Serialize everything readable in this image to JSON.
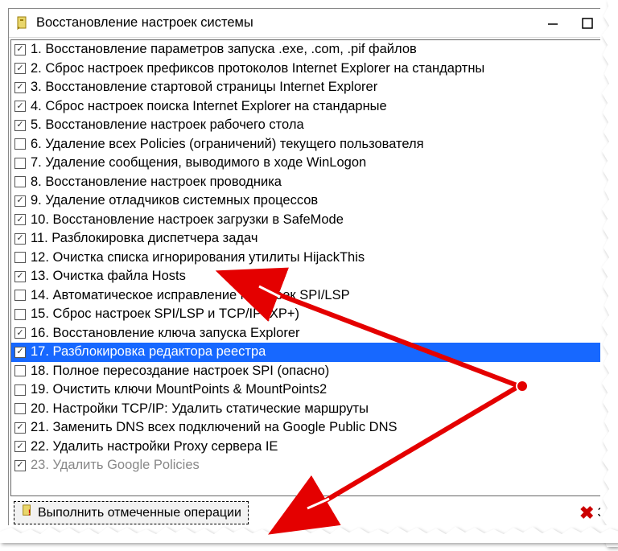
{
  "window": {
    "title": "Восстановление настроек системы"
  },
  "items": [
    {
      "checked": true,
      "label": "1. Восстановление параметров запуска .exe, .com, .pif файлов"
    },
    {
      "checked": true,
      "label": "2. Сброс настроек префиксов протоколов Internet Explorer на стандартны"
    },
    {
      "checked": true,
      "label": "3. Восстановление стартовой страницы Internet Explorer"
    },
    {
      "checked": true,
      "label": "4. Сброс настроек поиска Internet Explorer на стандарные"
    },
    {
      "checked": true,
      "label": "5. Восстановление настроек рабочего стола"
    },
    {
      "checked": false,
      "label": "6. Удаление всех Policies (ограничений) текущего пользователя"
    },
    {
      "checked": false,
      "label": "7. Удаление сообщения, выводимого в ходе WinLogon"
    },
    {
      "checked": false,
      "label": "8. Восстановление настроек проводника"
    },
    {
      "checked": true,
      "label": "9. Удаление отладчиков системных процессов"
    },
    {
      "checked": true,
      "label": "10. Восстановление настроек загрузки в SafeMode"
    },
    {
      "checked": true,
      "label": "11. Разблокировка диспетчера задач"
    },
    {
      "checked": false,
      "label": "12. Очистка списка игнорирования утилиты HijackThis"
    },
    {
      "checked": true,
      "label": "13. Очистка файла Hosts"
    },
    {
      "checked": false,
      "label": "14. Автоматическое исправление настроек SPI/LSP"
    },
    {
      "checked": false,
      "label": "15. Сброс настроек SPI/LSP и TCP/IP (XP+)"
    },
    {
      "checked": true,
      "label": "16. Восстановление ключа запуска Explorer"
    },
    {
      "checked": true,
      "label": "17. Разблокировка редактора реестра",
      "selected": true
    },
    {
      "checked": false,
      "label": "18. Полное пересоздание настроек SPI (опасно)"
    },
    {
      "checked": false,
      "label": "19. Очистить ключи MountPoints & MountPoints2"
    },
    {
      "checked": false,
      "label": "20. Настройки TCP/IP: Удалить статические маршруты"
    },
    {
      "checked": true,
      "label": "21. Заменить DNS всех подключений на Google Public DNS"
    },
    {
      "checked": true,
      "label": "22. Удалить настройки Proxy сервера IE"
    },
    {
      "checked": true,
      "label": "23. Удалить Google Policies",
      "partial": true
    }
  ],
  "buttons": {
    "execute": "Выполнить отмеченные операции",
    "close": "За"
  }
}
